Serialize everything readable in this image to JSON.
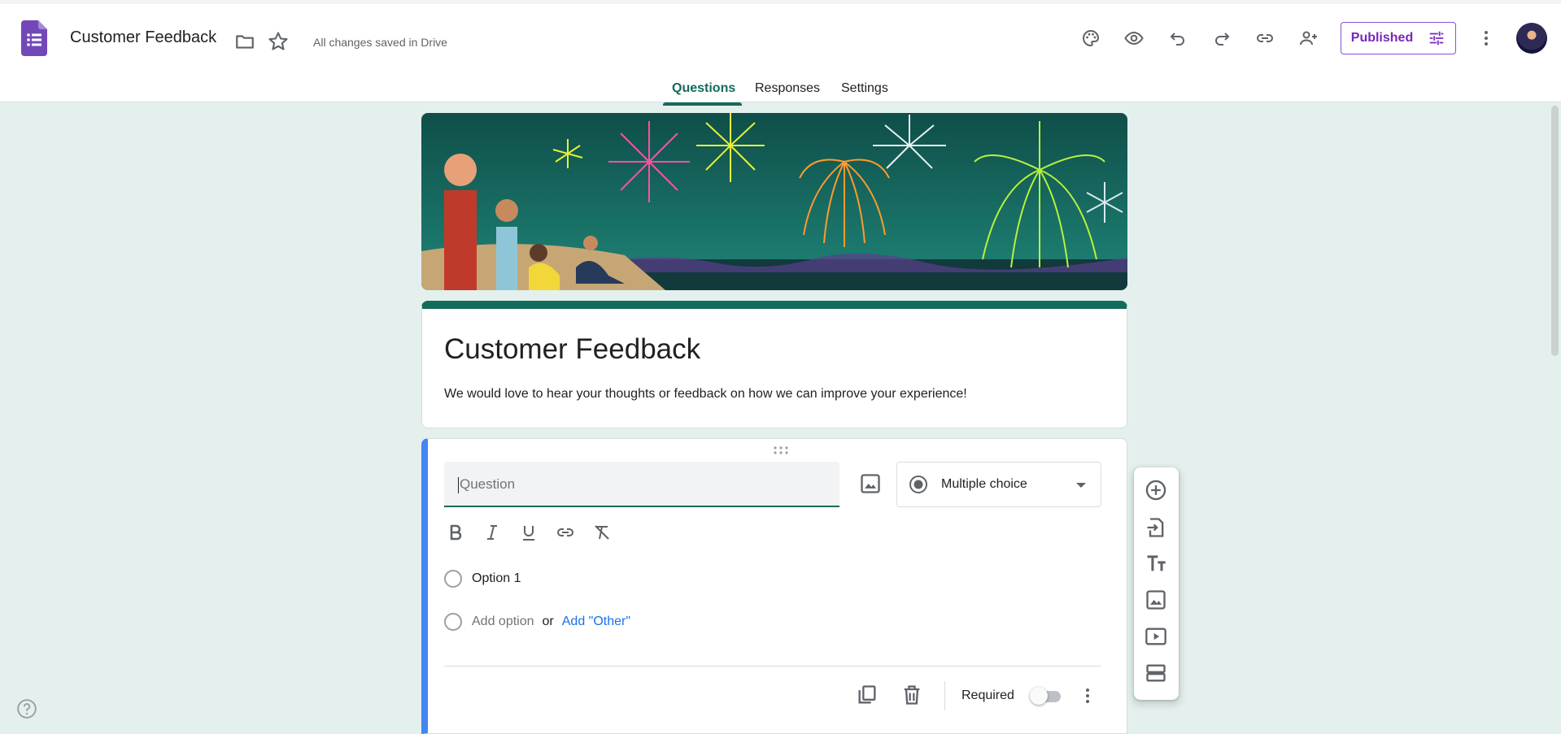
{
  "header": {
    "doc_title": "Customer Feedback",
    "save_status": "All changes saved in Drive",
    "publish_label": "Published",
    "icons": [
      "palette-icon",
      "preview-icon",
      "undo-icon",
      "redo-icon",
      "link-icon",
      "add-collaborator-icon",
      "more-vert-icon"
    ]
  },
  "tabs": [
    {
      "label": "Questions",
      "active": true
    },
    {
      "label": "Responses",
      "active": false
    },
    {
      "label": "Settings",
      "active": false
    }
  ],
  "form": {
    "title": "Customer Feedback",
    "description": "We would love to hear your thoughts or feedback on how we can improve your experience!"
  },
  "question": {
    "placeholder": "Question",
    "type": "Multiple choice",
    "options": [
      "Option 1"
    ],
    "add_option": "Add option",
    "or": "or",
    "add_other": "Add \"Other\"",
    "required_label": "Required",
    "required": false
  },
  "colors": {
    "theme": "#136b5a",
    "background": "#e4f0ee",
    "accent_blue": "#4285f4",
    "published": "#7627bb"
  }
}
